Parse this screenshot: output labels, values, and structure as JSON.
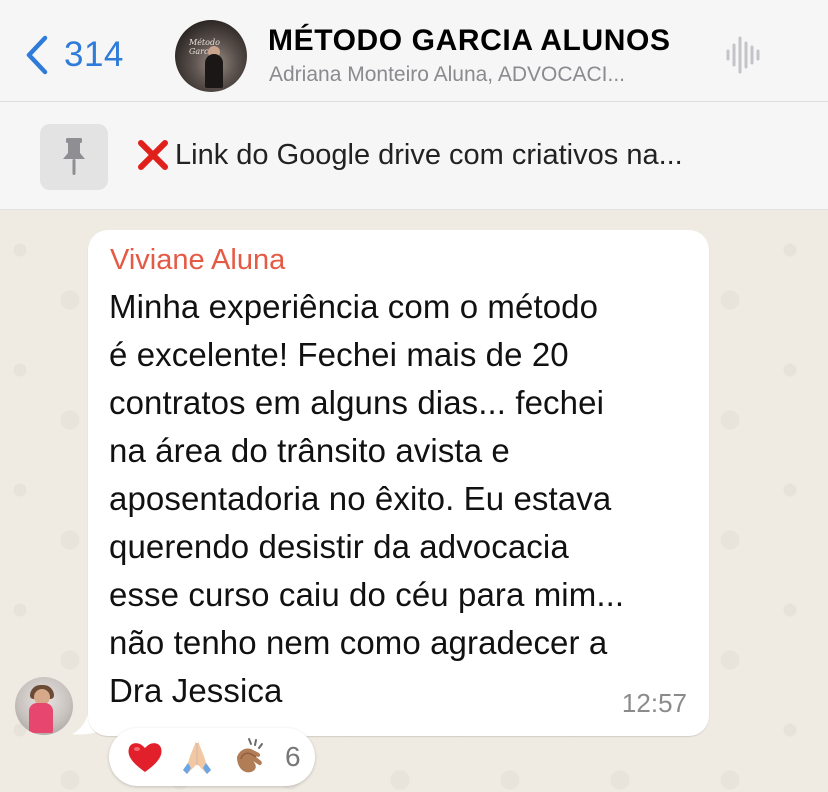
{
  "header": {
    "back_count": "314",
    "title": "MÉTODO GARCIA ALUNOS",
    "subtitle": "Adriana Monteiro Aluna, ADVOCACI...",
    "avatar_text": "Método Garcia",
    "back_icon": "chevron-left-icon",
    "audio_icon": "audio-waveform-icon",
    "accent_color": "#2f7bd9"
  },
  "pinned": {
    "icon": "pin-icon",
    "prefix_icon": "red-x-icon",
    "text": "Link do Google drive com criativos na..."
  },
  "message": {
    "sender": "Viviane Aluna",
    "sender_color": "#e55a44",
    "lines": [
      "Minha experiência com o método",
      "é excelente! Fechei mais de 20",
      "contratos em alguns dias... fechei",
      "na área do trânsito avista e",
      "aposentadoria no êxito. Eu estava",
      "querendo desistir da advocacia",
      "esse curso caiu do céu para mim...",
      "não tenho nem como agradecer a",
      "Dra Jessica"
    ],
    "time": "12:57"
  },
  "reactions": {
    "icons": [
      "red-heart-icon",
      "folded-hands-icon",
      "clapping-hands-icon"
    ],
    "count": "6"
  }
}
